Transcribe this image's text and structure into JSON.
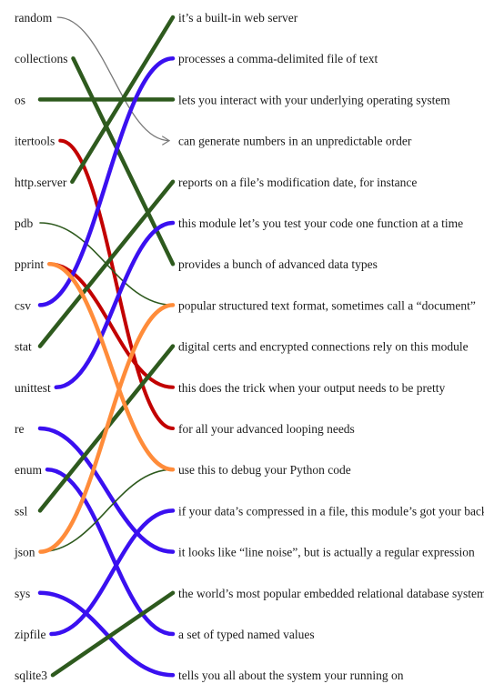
{
  "left_items": [
    "random",
    "collections",
    "os",
    "itertools",
    "http.server",
    "pdb",
    "pprint",
    "csv",
    "stat",
    "unittest",
    "re",
    "enum",
    "ssl",
    "json",
    "sys",
    "zipfile",
    "sqlite3"
  ],
  "right_items": [
    "it’s a built-in web server",
    "processes a comma-delimited file of text",
    "lets you interact with your underlying operating system",
    "can generate numbers in an unpredictable order",
    "reports on a file’s modification date, for instance",
    "this module let’s you test your code one function at a time",
    "provides a bunch of advanced data types",
    "popular structured text format, sometimes call a “document”",
    "digital certs and encrypted connections rely on this module",
    "this does the trick when your output needs to be pretty",
    "for all your advanced looping needs",
    "use this to debug your Python code",
    "if your data’s compressed in a file, this module’s got your back",
    "it looks like “line noise”, but is actually a regular expression",
    "the world’s most popular embedded relational database system",
    "a set of typed named values",
    "tells you all about the system your running on"
  ],
  "connections": [
    {
      "from": 0,
      "to": 3,
      "style": "arrow"
    },
    {
      "from": 1,
      "to": 6,
      "style": "green"
    },
    {
      "from": 2,
      "to": 2,
      "style": "green"
    },
    {
      "from": 3,
      "to": 10,
      "style": "red"
    },
    {
      "from": 4,
      "to": 0,
      "style": "green"
    },
    {
      "from": 5,
      "to": 7,
      "style": "ribbon"
    },
    {
      "from": 6,
      "to": 9,
      "style": "red"
    },
    {
      "from": 7,
      "to": 1,
      "style": "blue"
    },
    {
      "from": 8,
      "to": 4,
      "style": "green"
    },
    {
      "from": 9,
      "to": 5,
      "style": "blue"
    },
    {
      "from": 10,
      "to": 13,
      "style": "blue"
    },
    {
      "from": 11,
      "to": 15,
      "style": "blue"
    },
    {
      "from": 12,
      "to": 8,
      "style": "green"
    },
    {
      "from": 13,
      "to": 11,
      "style": "ribbon"
    },
    {
      "from": 14,
      "to": 16,
      "style": "blue"
    },
    {
      "from": 15,
      "to": 12,
      "style": "blue"
    },
    {
      "from": 16,
      "to": 14,
      "style": "green"
    },
    {
      "from": 6,
      "to": 11,
      "style": "orange"
    },
    {
      "from": 13,
      "to": 7,
      "style": "orange"
    }
  ],
  "colors": {
    "green": "#2e5a1e",
    "red": "#c20000",
    "blue": "#3a10f0",
    "orange": "#ff8c3a",
    "arrow": "#777777",
    "ribbon": "#2e5a1e"
  }
}
